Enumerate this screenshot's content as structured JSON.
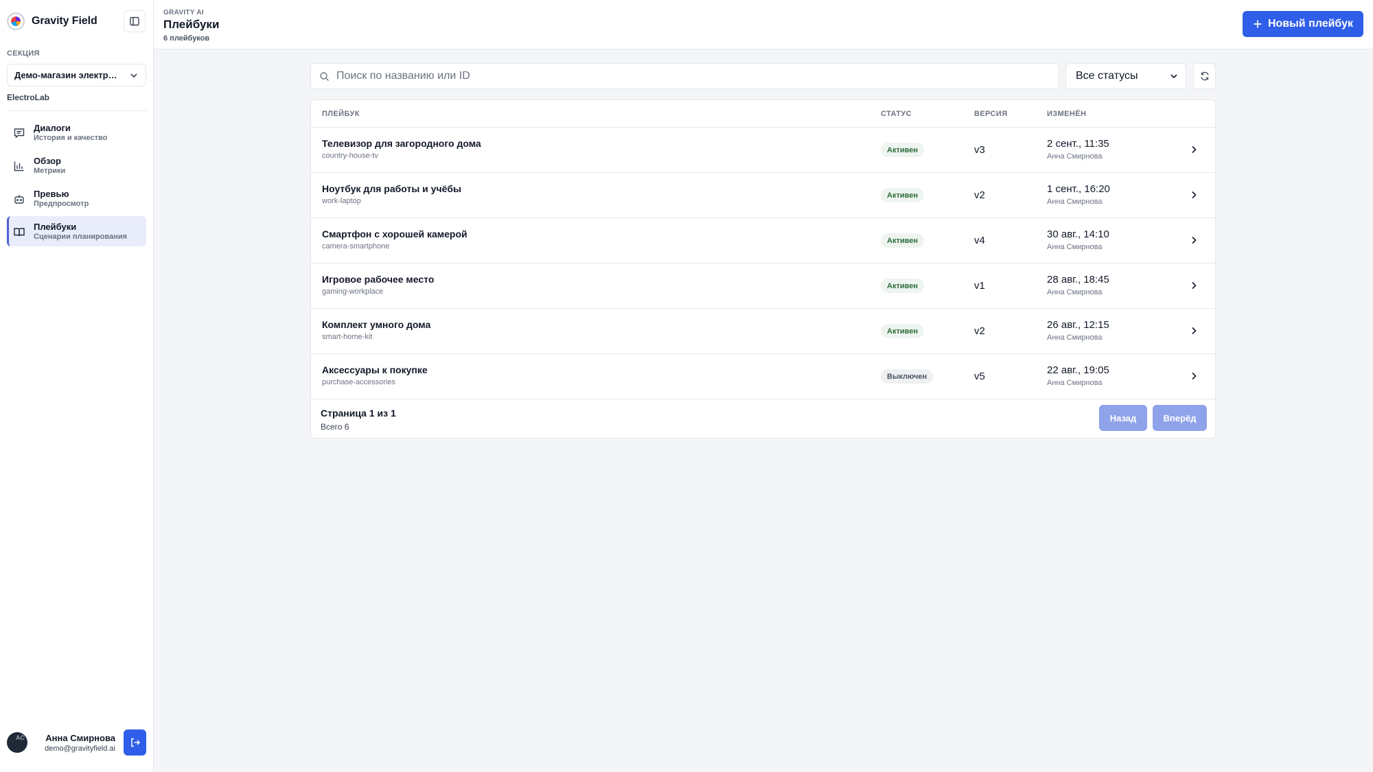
{
  "sidebar": {
    "brand": "Gravity Field",
    "section_label": "СЕКЦИЯ",
    "section_value": "Демо-магазин электро...",
    "org": "ElectroLab",
    "items": [
      {
        "title": "Диалоги",
        "subtitle": "История и качество",
        "icon": "chat-icon"
      },
      {
        "title": "Обзор",
        "subtitle": "Метрики",
        "icon": "bar-chart-icon"
      },
      {
        "title": "Превью",
        "subtitle": "Предпросмотр",
        "icon": "robot-icon"
      },
      {
        "title": "Плейбуки",
        "subtitle": "Сценарии планирования",
        "icon": "book-icon",
        "active": true
      }
    ],
    "user": {
      "initials": "AC",
      "name": "Анна Смирнова",
      "email": "demo@gravityfield.ai"
    }
  },
  "header": {
    "crumb": "GRAVITY AI",
    "title": "Плейбуки",
    "subtitle": "6 плейбуков",
    "new_button": "Новый плейбук"
  },
  "toolbar": {
    "search_placeholder": "Поиск по названию или ID",
    "status_filter": "Все статусы"
  },
  "table": {
    "columns": [
      "ПЛЕЙБУК",
      "СТАТУС",
      "ВЕРСИЯ",
      "ИЗМЕНЁН"
    ],
    "rows": [
      {
        "name": "Телевизор для загородного дома",
        "id": "country-house-tv",
        "status": "Активен",
        "active": true,
        "version": "v3",
        "date": "2 сент., 11:35",
        "author": "Анна Смирнова"
      },
      {
        "name": "Ноутбук для работы и учёбы",
        "id": "work-laptop",
        "status": "Активен",
        "active": true,
        "version": "v2",
        "date": "1 сент., 16:20",
        "author": "Анна Смирнова"
      },
      {
        "name": "Смартфон с хорошей камерой",
        "id": "camera-smartphone",
        "status": "Активен",
        "active": true,
        "version": "v4",
        "date": "30 авг., 14:10",
        "author": "Анна Смирнова"
      },
      {
        "name": "Игровое рабочее место",
        "id": "gaming-workplace",
        "status": "Активен",
        "active": true,
        "version": "v1",
        "date": "28 авг., 18:45",
        "author": "Анна Смирнова"
      },
      {
        "name": "Комплект умного дома",
        "id": "smart-home-kit",
        "status": "Активен",
        "active": true,
        "version": "v2",
        "date": "26 авг., 12:15",
        "author": "Анна Смирнова"
      },
      {
        "name": "Аксессуары к покупке",
        "id": "purchase-accessories",
        "status": "Выключен",
        "active": false,
        "version": "v5",
        "date": "22 авг., 19:05",
        "author": "Анна Смирнова"
      }
    ]
  },
  "pagination": {
    "page_info": "Страница 1 из 1",
    "total": "Всего 6",
    "prev": "Назад",
    "next": "Вперёд"
  },
  "colors": {
    "accent": "#2f5ee8",
    "active_nav": "#e9ecfb",
    "badge_active": "#2f6b3a"
  }
}
